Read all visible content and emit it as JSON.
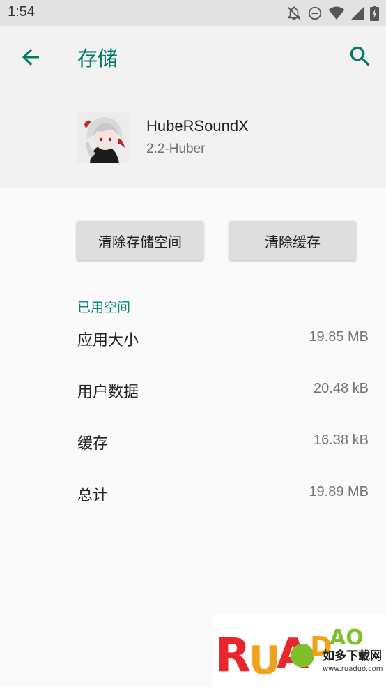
{
  "status_bar": {
    "time": "1:54",
    "icons": [
      "notifications-off-icon",
      "do-not-disturb-icon",
      "wifi-icon",
      "signal-icon",
      "battery-charging-icon"
    ]
  },
  "app_bar": {
    "title": "存储",
    "back_icon": "arrow-back-icon",
    "search_icon": "search-icon",
    "accent_color": "#00796b"
  },
  "app_info": {
    "name": "HubeRSoundX",
    "version": "2.2-Huber"
  },
  "actions": {
    "clear_storage": "清除存储空间",
    "clear_cache": "清除缓存"
  },
  "storage": {
    "section_title": "已用空间",
    "rows": [
      {
        "label": "应用大小",
        "value": "19.85 MB"
      },
      {
        "label": "用户数据",
        "value": "20.48 kB"
      },
      {
        "label": "缓存",
        "value": "16.38 kB"
      },
      {
        "label": "总计",
        "value": "19.89 MB"
      }
    ]
  },
  "watermark": {
    "brand": "RUANDAO",
    "subtitle": "如多下载网",
    "url": "www.ruaduo.com"
  }
}
